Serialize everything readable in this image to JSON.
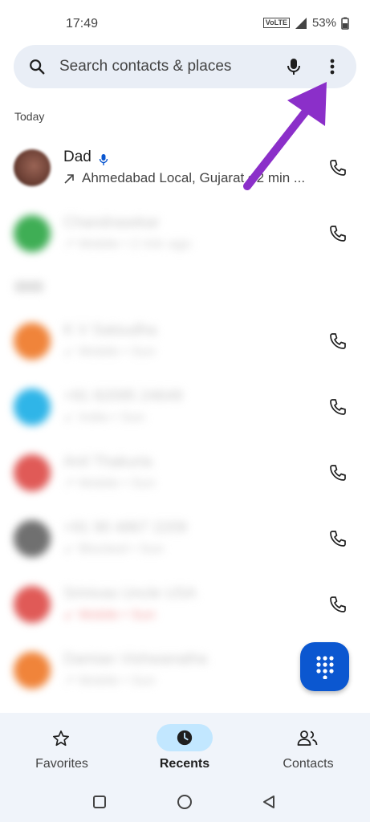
{
  "status_bar": {
    "time": "17:49",
    "volte": "VoLTE",
    "battery": "53%"
  },
  "search": {
    "placeholder": "Search contacts & places"
  },
  "sections": {
    "today": "Today"
  },
  "calls": [
    {
      "name": "Dad",
      "detail": "Ahmedabad Local, Gujarat • 2 min ...",
      "avatar_color": "#7a4b3e"
    }
  ],
  "blurred_rows": [
    {
      "avatar_color": "#3fae55",
      "line1": "Chandrasekar",
      "line2": "↗ Mobile • 2 min ago"
    },
    {
      "avatar_color": "#f0843a",
      "line1": "K V Satsudha",
      "line2": "↙ Mobile • Sun"
    },
    {
      "avatar_color": "#2fb5e8",
      "line1": "+91 82095 24649",
      "line2": "↙ India • Sun"
    },
    {
      "avatar_color": "#e05a57",
      "line1": "Anil Thakuria",
      "line2": "↗ Mobile • Sun"
    },
    {
      "avatar_color": "#707070",
      "line1": "+91 90 4867 2209",
      "line2": "↙ Blocked • Sun"
    },
    {
      "avatar_color": "#e05a57",
      "line1": "Srinivas Uncle USA",
      "line2": "↙ Mobile • Sun"
    },
    {
      "avatar_color": "#f0843a",
      "line1": "Damian Vishwanatha",
      "line2": "↗ Mobile • Sun"
    }
  ],
  "nav": {
    "favorites": "Favorites",
    "recents": "Recents",
    "contacts": "Contacts"
  },
  "colors": {
    "accent": "#0b57d0",
    "annotation_arrow": "#8b2fc9",
    "nav_pill": "#c2e7ff"
  }
}
